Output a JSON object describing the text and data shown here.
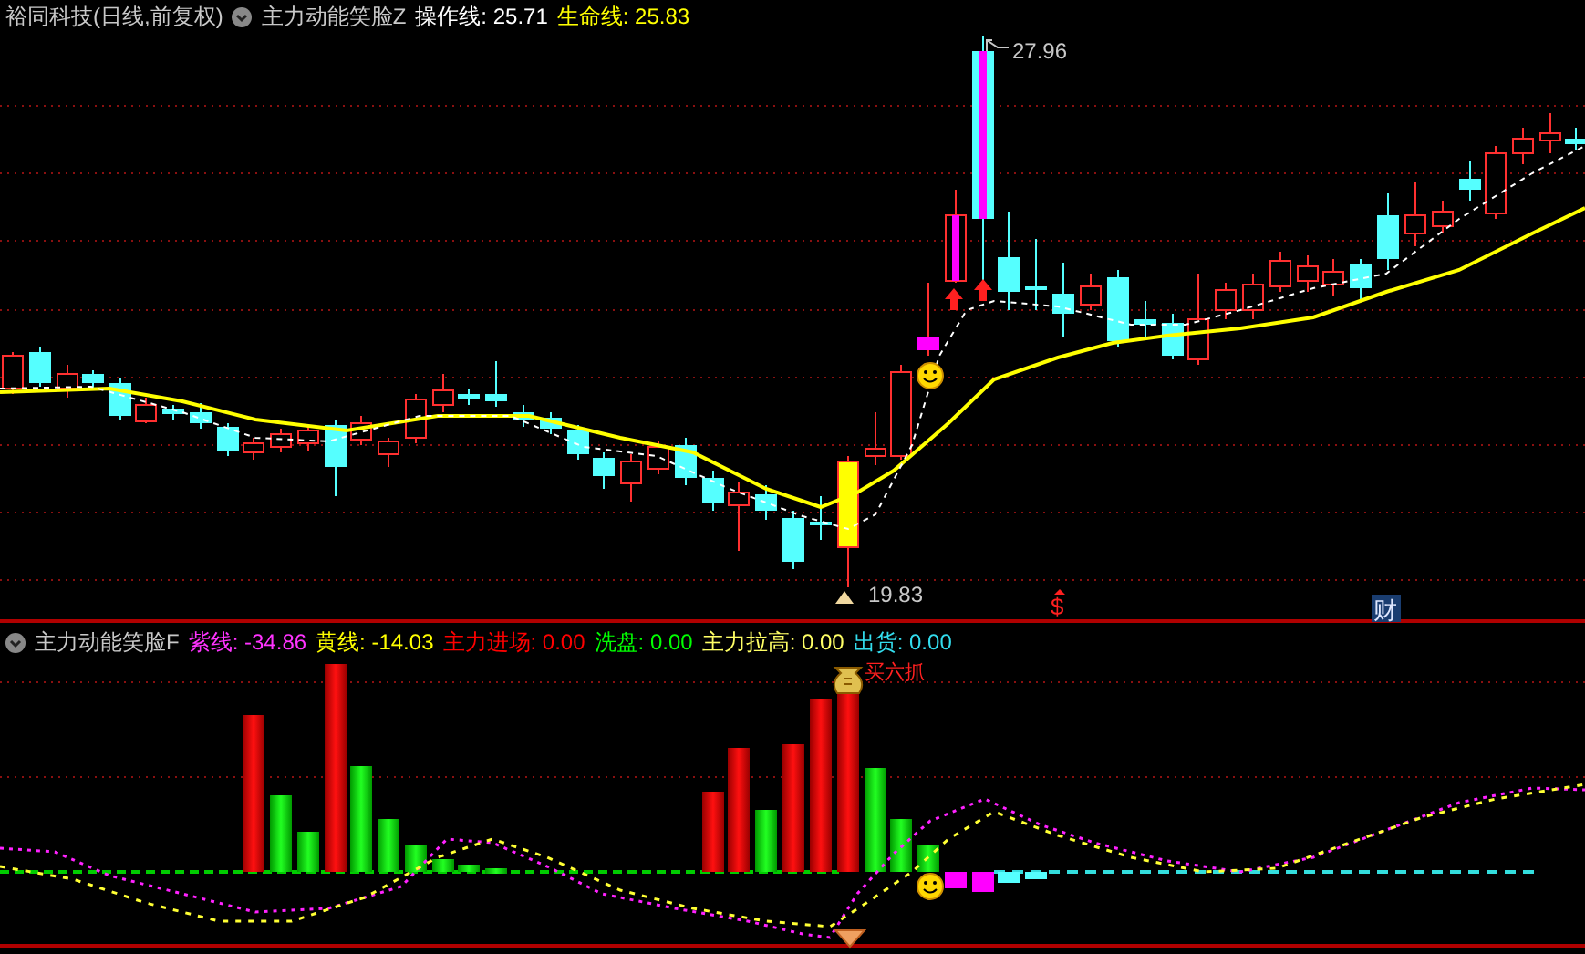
{
  "price_panel": {
    "title": "裕同科技(日线,前复权)",
    "indicator": "主力动能笑脸Z",
    "readings": [
      {
        "label": "操作线:",
        "value": "25.71",
        "color": "#ffffff"
      },
      {
        "label": "生命线:",
        "value": "25.83",
        "color": "#ffff00"
      }
    ],
    "high_label": "27.96",
    "low_label": "19.83",
    "markers": [
      {
        "kind": "dollar",
        "text": "$"
      },
      {
        "kind": "finance",
        "text": "财"
      }
    ]
  },
  "indicator_panel": {
    "indicator": "主力动能笑脸F",
    "readings": [
      {
        "label": "紫线:",
        "value": "-34.86",
        "color": "#ff33ff"
      },
      {
        "label": "黄线:",
        "value": "-14.03",
        "color": "#ffff00"
      },
      {
        "label": "主力进场:",
        "value": "0.00",
        "color": "#ff0000"
      },
      {
        "label": "洗盘:",
        "value": "0.00",
        "color": "#00ff00"
      },
      {
        "label": "主力拉高:",
        "value": "0.00",
        "color": "#ffff66"
      },
      {
        "label": "出货:",
        "value": "0.00",
        "color": "#33ddee"
      }
    ],
    "signal_label": "买六抓"
  }
}
